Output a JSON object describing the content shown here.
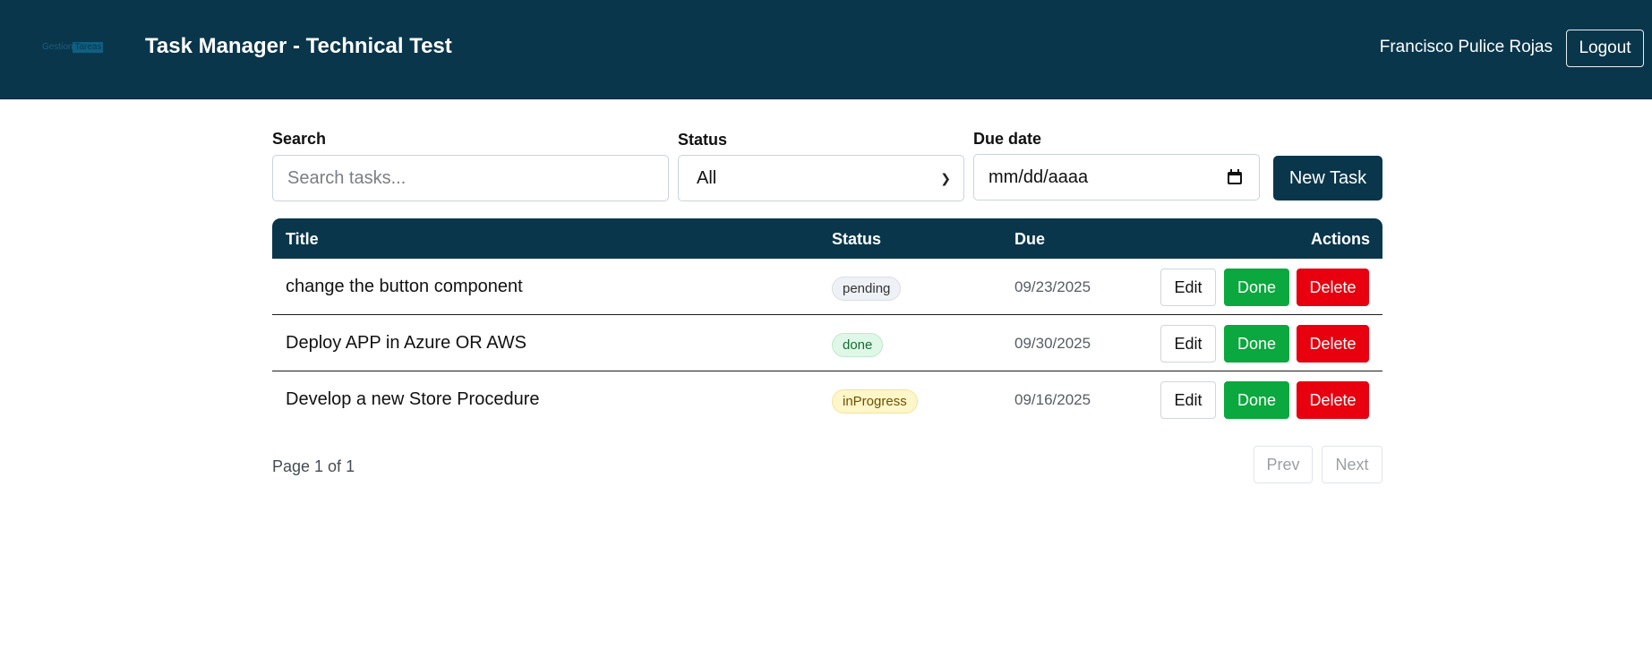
{
  "header": {
    "logo_part1": "Gestion",
    "logo_part2": "Tareas",
    "title": "Task Manager - Technical Test",
    "user_name": "Francisco Pulice Rojas",
    "logout_label": "Logout"
  },
  "filters": {
    "search_label": "Search",
    "search_placeholder": "Search tasks...",
    "search_value": "",
    "status_label": "Status",
    "status_selected": "All",
    "due_label": "Due date",
    "due_placeholder": "mm/dd/aaaa",
    "new_task_label": "New Task"
  },
  "table": {
    "headers": {
      "title": "Title",
      "status": "Status",
      "due": "Due",
      "actions": "Actions"
    },
    "rows": [
      {
        "title": "change the button component",
        "status": "pending",
        "due": "09/23/2025",
        "edit": "Edit",
        "done": "Done",
        "delete": "Delete"
      },
      {
        "title": "Deploy APP in Azure OR AWS",
        "status": "done",
        "due": "09/30/2025",
        "edit": "Edit",
        "done": "Done",
        "delete": "Delete"
      },
      {
        "title": "Develop a new Store Procedure",
        "status": "inProgress",
        "due": "09/16/2025",
        "edit": "Edit",
        "done": "Done",
        "delete": "Delete"
      }
    ]
  },
  "pagination": {
    "info": "Page 1 of 1",
    "prev_label": "Prev",
    "next_label": "Next"
  },
  "colors": {
    "header_bg": "#0a364b",
    "done_button": "#0aa83e",
    "delete_button": "#e8000f"
  },
  "icons": {
    "status_select": "chevron-down-icon",
    "date_picker": "calendar-icon"
  }
}
